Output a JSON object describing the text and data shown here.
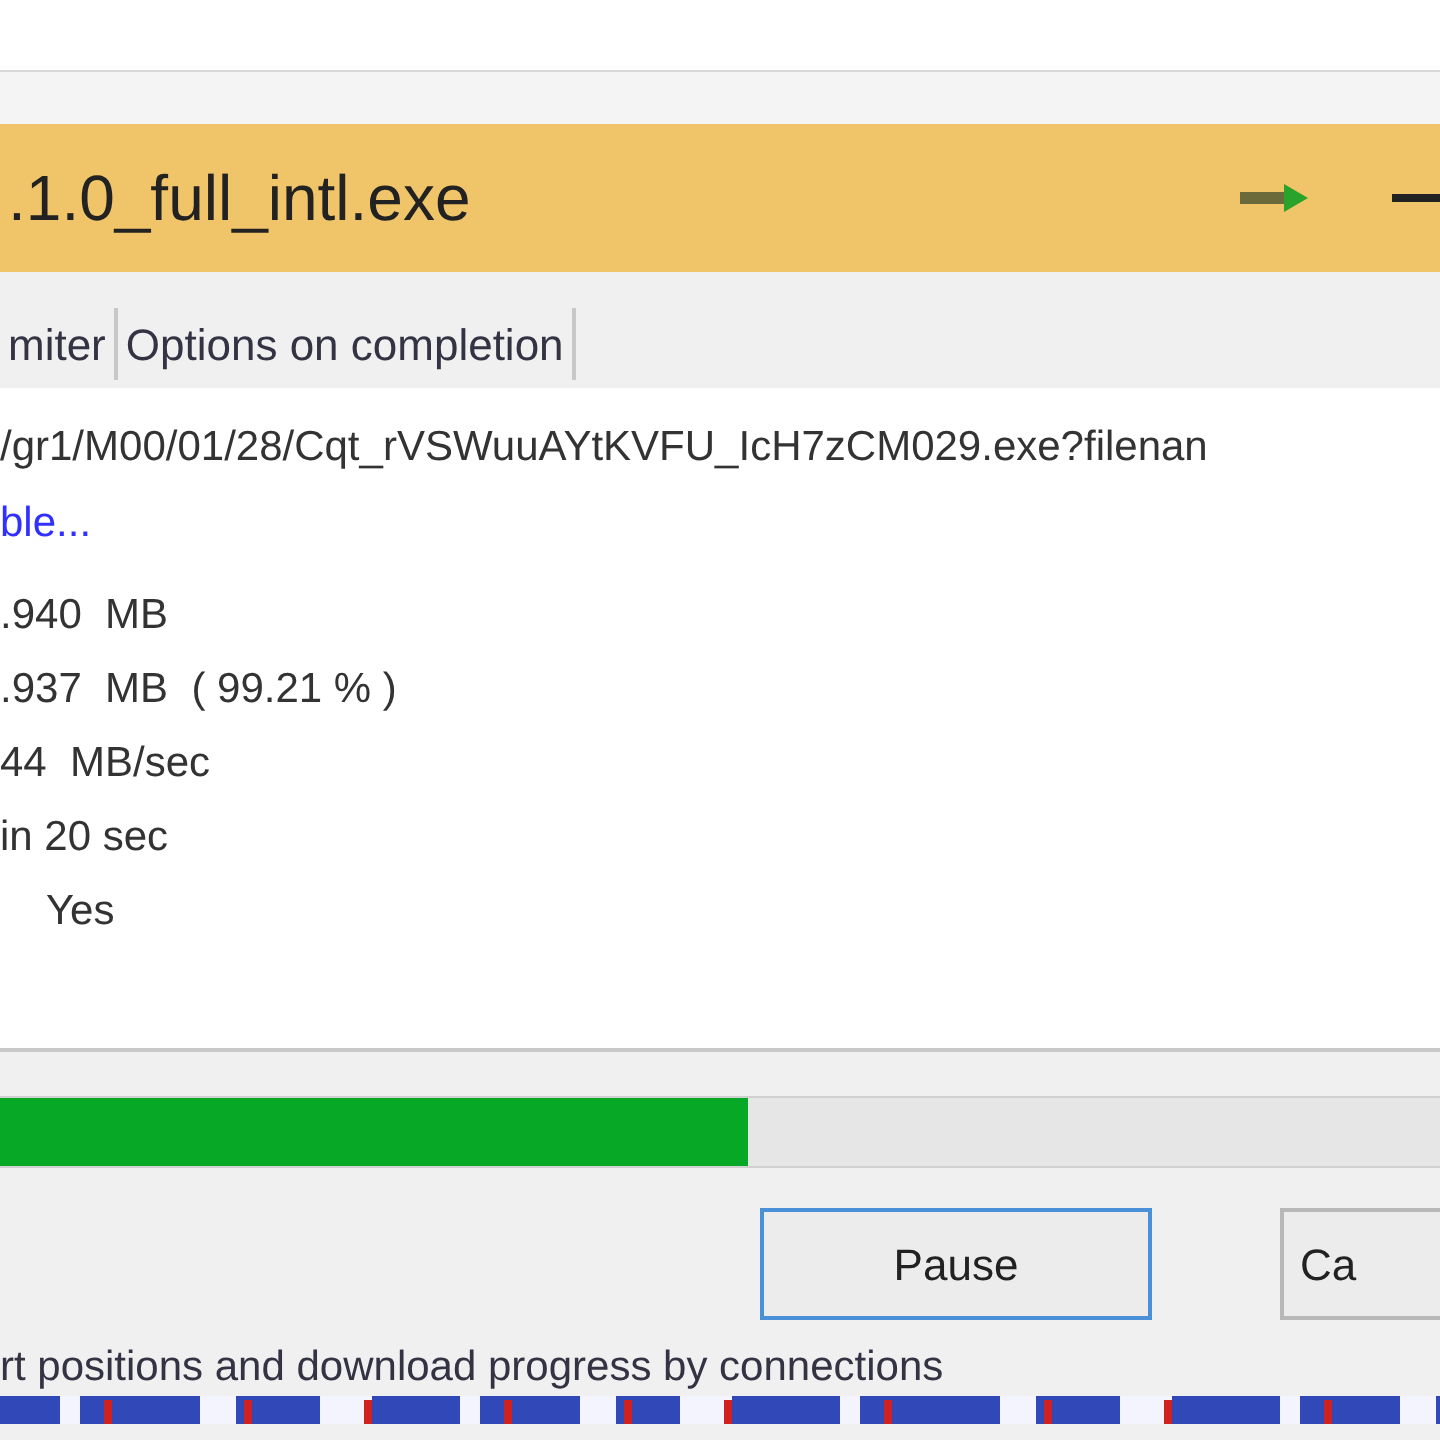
{
  "window": {
    "title": ".1.0_full_intl.exe"
  },
  "tabs": [
    {
      "label": "miter",
      "selected": false
    },
    {
      "label": "Options on completion",
      "selected": false
    }
  ],
  "url": "/gr1/M00/01/28/Cqt_rVSWuuAYtKVFU_IcH7zCM029.exe?filenan",
  "link": "ble...",
  "info_lines": [
    ".940  MB",
    ".937  MB  ( 99.21 % )",
    "44  MB/sec",
    "in 20 sec",
    "    Yes"
  ],
  "progress": {
    "level": 0.52
  },
  "buttons": [
    {
      "label": "Pause",
      "selected": true
    },
    {
      "label": "Ca",
      "selected": false
    }
  ],
  "footer": "rt positions and download progress by connections"
}
